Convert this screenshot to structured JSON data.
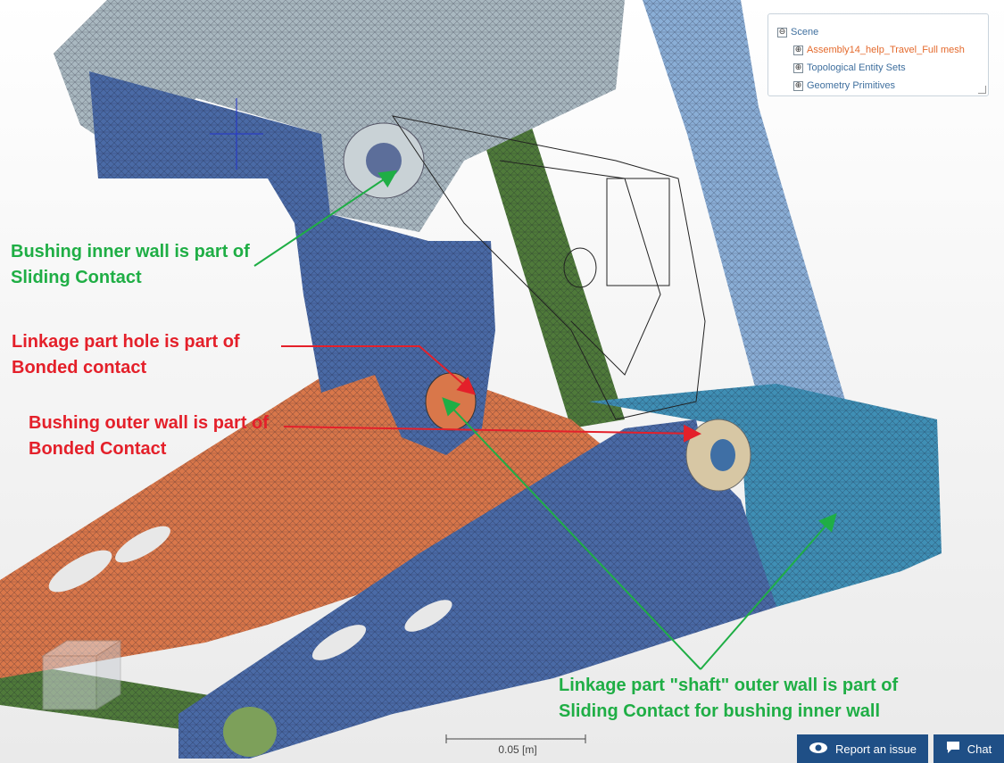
{
  "scene_tree": {
    "root_label": "Scene",
    "root_toggle": "⊖",
    "items": [
      {
        "label": "Assembly14_help_Travel_Full mesh",
        "toggle": "⊕",
        "active": true
      },
      {
        "label": "Topological Entity Sets",
        "toggle": "⊕",
        "active": false
      },
      {
        "label": "Geometry Primitives",
        "toggle": "⊕",
        "active": false
      }
    ]
  },
  "annotations": {
    "bushing_inner": "Bushing inner wall is part of\nSliding Contact",
    "linkage_hole": "Linkage part hole is part of\nBonded contact",
    "bushing_outer": "Bushing outer wall is part of\nBonded Contact",
    "linkage_shaft": "Linkage part \"shaft\" outer wall is part of\nSliding Contact for bushing inner wall"
  },
  "colors": {
    "annotation_green": "#1fae45",
    "annotation_red": "#e4202a",
    "button_bg": "#1f4f86",
    "part_blue": "#4a6aa6",
    "part_light_blue": "#8aaed6",
    "part_gray": "#a9b8c0",
    "part_orange": "#d9774a",
    "part_green": "#4f7a3a",
    "part_teal": "#3f8fb5",
    "bushing": "#d7c7a4"
  },
  "scale_bar": {
    "label": "0.05 [m]"
  },
  "buttons": {
    "report": {
      "label": "Report an issue",
      "icon": "eye-icon"
    },
    "chat": {
      "label": "Chat",
      "icon": "chat-bubble-icon"
    }
  }
}
